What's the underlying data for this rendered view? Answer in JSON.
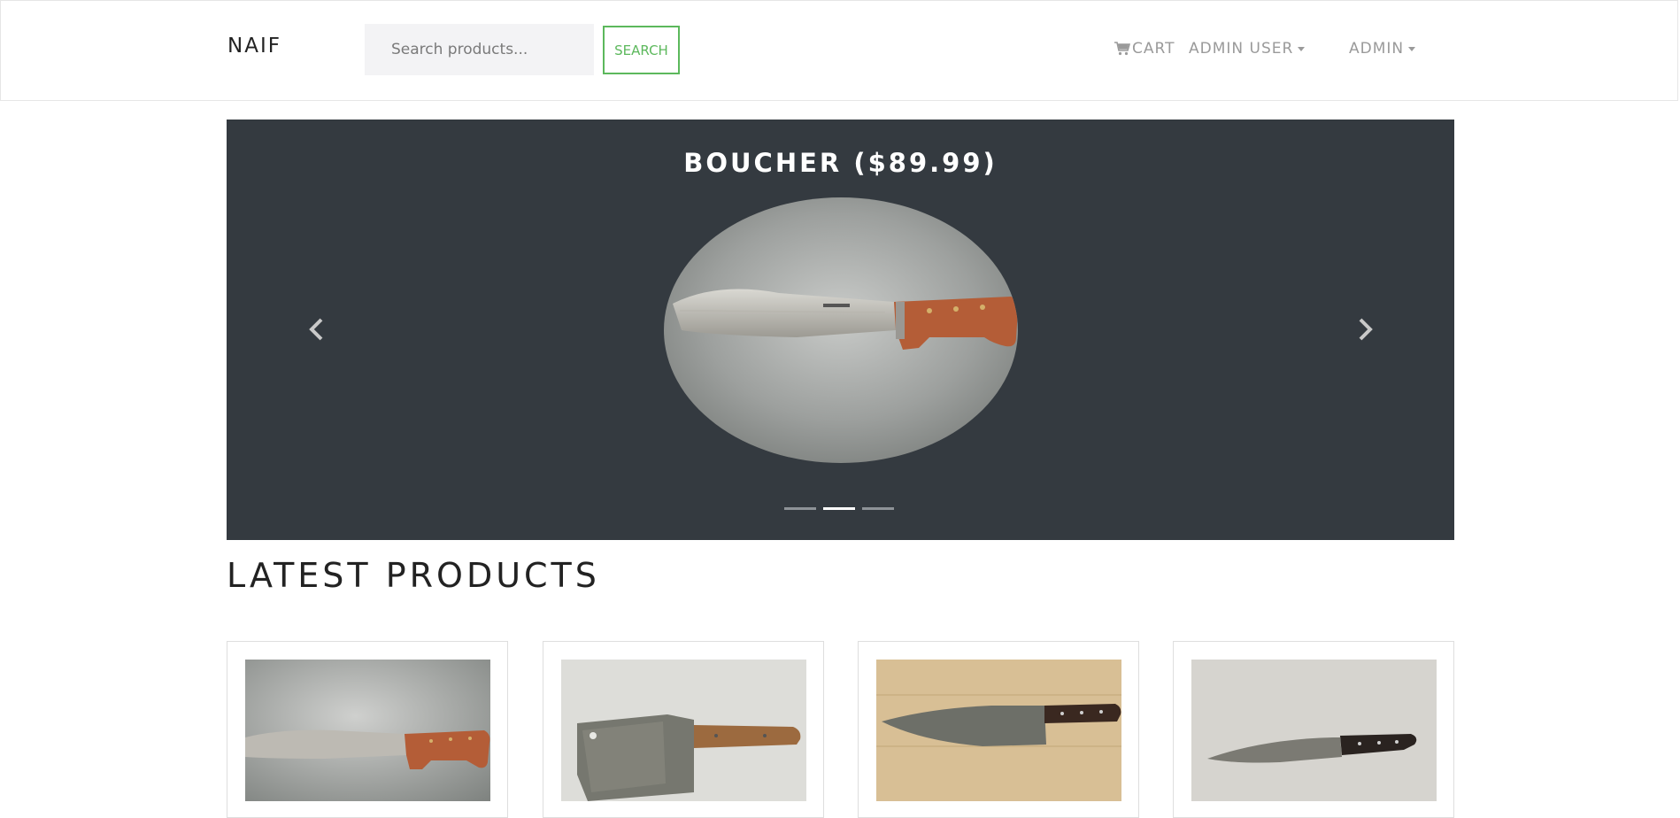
{
  "brand": "NAIF",
  "search": {
    "placeholder": "Search products...",
    "button_label": "SEARCH"
  },
  "nav": {
    "cart_label": "CART",
    "cart_icon": "cart-icon",
    "user_label": "ADMIN USER",
    "admin_label": "ADMIN"
  },
  "carousel": {
    "slide_title": "BOUCHER ($89.99)",
    "prev_icon": "chevron-left-icon",
    "next_icon": "chevron-right-icon",
    "indicator_count": 3,
    "active_indicator": 2
  },
  "latest_products": {
    "title": "LATEST PRODUCTS"
  },
  "colors": {
    "accent": "#5cb85c",
    "carousel_bg": "#343a40",
    "nav_text": "#9a9a9a"
  }
}
